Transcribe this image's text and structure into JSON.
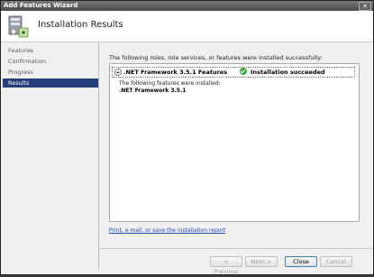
{
  "window": {
    "title": "Add Features Wizard",
    "close_label": "✕"
  },
  "header": {
    "title": "Installation Results",
    "icon": "server-features-icon"
  },
  "sidebar": {
    "items": [
      {
        "label": "Features",
        "active": false
      },
      {
        "label": "Confirmation",
        "active": false
      },
      {
        "label": "Progress",
        "active": false
      },
      {
        "label": "Results",
        "active": true
      }
    ]
  },
  "main": {
    "description": "The following roles, role services, or features were installed successfully:",
    "result": {
      "feature": ".NET Framework 3.5.1 Features",
      "status": "Installation succeeded",
      "detail_intro": "The following features were installed:",
      "detail_item": ".NET Framework 3.5.1"
    },
    "link_text": "Print, e-mail, or save the installation report"
  },
  "buttons": {
    "previous": "< Previous",
    "next": "Next >",
    "close": "Close",
    "cancel": "Cancel"
  },
  "colors": {
    "active_nav": "#263e7a",
    "success": "#3aa83a",
    "link": "#1a4ab8"
  }
}
